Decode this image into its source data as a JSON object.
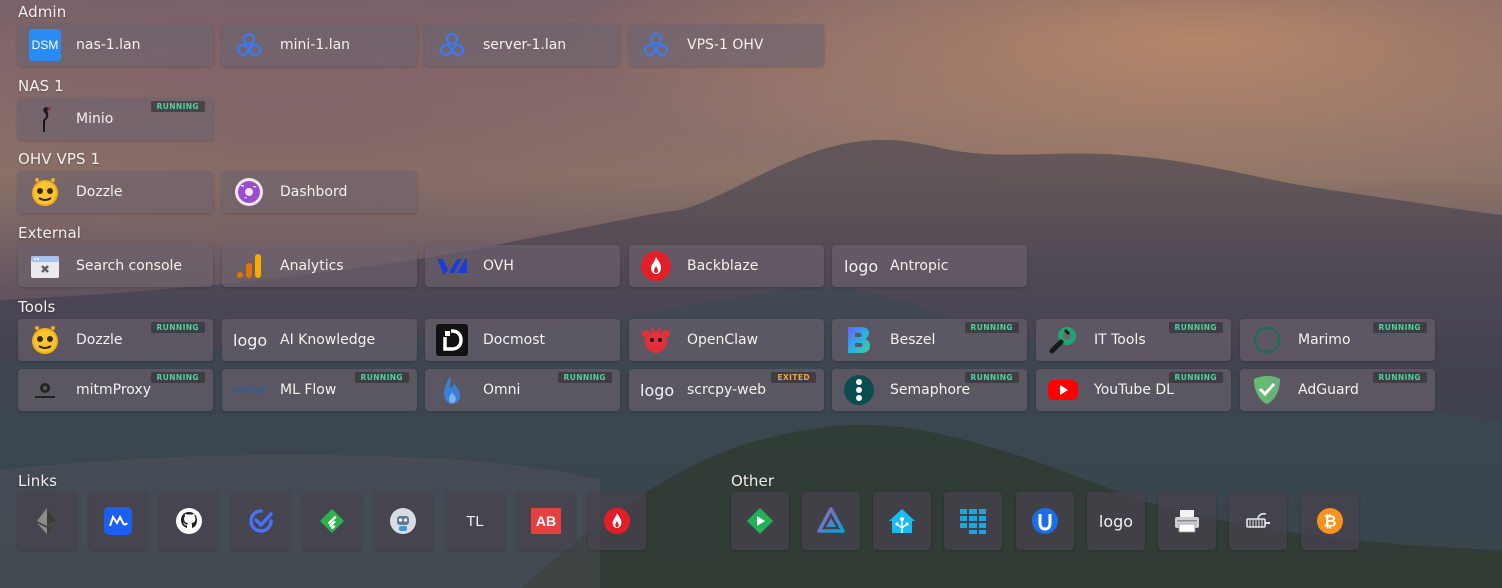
{
  "groups": {
    "admin": {
      "title": "Admin",
      "items": [
        {
          "label": "nas-1.lan",
          "icon": "synology-dsm-icon",
          "icon_text": "DSM"
        },
        {
          "label": "mini-1.lan",
          "icon": "proxmox-cluster-icon"
        },
        {
          "label": "server-1.lan",
          "icon": "proxmox-cluster-icon"
        },
        {
          "label": "VPS-1 OHV",
          "icon": "proxmox-cluster-icon"
        }
      ]
    },
    "nas1": {
      "title": "NAS 1",
      "items": [
        {
          "label": "Minio",
          "icon": "minio-bird-icon",
          "status": "RUNNING"
        }
      ]
    },
    "ohv": {
      "title": "OHV VPS 1",
      "items": [
        {
          "label": "Dozzle",
          "icon": "dozzle-mascot-icon"
        },
        {
          "label": "Dashbord",
          "icon": "donut-icon"
        }
      ]
    },
    "external": {
      "title": "External",
      "items": [
        {
          "label": "Search console",
          "icon": "search-console-icon"
        },
        {
          "label": "Analytics",
          "icon": "analytics-bars-icon"
        },
        {
          "label": "OVH",
          "icon": "ovh-logo-icon"
        },
        {
          "label": "Backblaze",
          "icon": "backblaze-flame-icon"
        },
        {
          "label": "Antropic",
          "icon": "placeholder-logo-icon",
          "icon_text": "logo"
        }
      ]
    },
    "tools": {
      "title": "Tools",
      "items": [
        {
          "label": "Dozzle",
          "icon": "dozzle-mascot-icon",
          "status": "RUNNING"
        },
        {
          "label": "AI Knowledge",
          "icon": "placeholder-logo-icon",
          "icon_text": "logo"
        },
        {
          "label": "Docmost",
          "icon": "docmost-icon"
        },
        {
          "label": "OpenClaw",
          "icon": "openclaw-creature-icon"
        },
        {
          "label": "Beszel",
          "icon": "beszel-b-icon",
          "status": "RUNNING"
        },
        {
          "label": "IT Tools",
          "icon": "it-tools-wrench-icon",
          "status": "RUNNING"
        },
        {
          "label": "Marimo",
          "icon": "marimo-ring-icon",
          "status": "RUNNING"
        },
        {
          "label": "mitmProxy",
          "icon": "mitmproxy-icon",
          "status": "RUNNING"
        },
        {
          "label": "ML Flow",
          "icon": "mlflow-icon",
          "icon_text": "mlflow",
          "status": "RUNNING"
        },
        {
          "label": "Omni",
          "icon": "omni-flame-icon",
          "status": "RUNNING"
        },
        {
          "label": "scrcpy-web",
          "icon": "placeholder-logo-icon",
          "icon_text": "logo",
          "status": "EXITED"
        },
        {
          "label": "Semaphore",
          "icon": "semaphore-dots-icon",
          "status": "RUNNING"
        },
        {
          "label": "YouTube DL",
          "icon": "youtube-play-icon",
          "status": "RUNNING"
        },
        {
          "label": "AdGuard",
          "icon": "adguard-shield-icon",
          "status": "RUNNING"
        }
      ]
    }
  },
  "links": {
    "title": "Links",
    "items": [
      {
        "icon": "ethereum-icon"
      },
      {
        "icon": "coinmarketcap-icon"
      },
      {
        "icon": "github-icon"
      },
      {
        "icon": "ticktick-check-icon"
      },
      {
        "icon": "feedly-icon"
      },
      {
        "icon": "robot-avatar-icon"
      },
      {
        "icon": "tl-text-icon",
        "icon_text": "TL"
      },
      {
        "icon": "ab-text-icon",
        "icon_text": "AB"
      },
      {
        "icon": "backblaze-flame-icon"
      }
    ]
  },
  "other": {
    "title": "Other",
    "items": [
      {
        "icon": "play-diamond-icon"
      },
      {
        "icon": "jellyfin-triangle-icon"
      },
      {
        "icon": "home-assistant-icon"
      },
      {
        "icon": "grid-blocks-icon"
      },
      {
        "icon": "uptime-u-icon"
      },
      {
        "icon": "placeholder-logo-icon",
        "icon_text": "logo"
      },
      {
        "icon": "printer-icon"
      },
      {
        "icon": "network-plug-icon"
      },
      {
        "icon": "bitcoin-icon"
      }
    ]
  },
  "colors": {
    "running": "#4fd39a",
    "exited": "#f0a548",
    "card_bg": "rgba(108,98,110,0.62)"
  }
}
